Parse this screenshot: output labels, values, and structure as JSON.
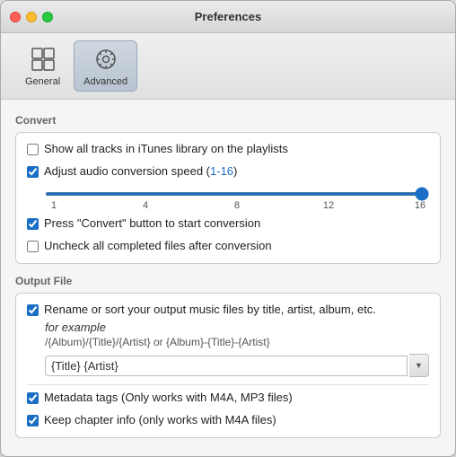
{
  "window": {
    "title": "Preferences"
  },
  "toolbar": {
    "buttons": [
      {
        "id": "general",
        "label": "General",
        "icon": "⊞",
        "active": false
      },
      {
        "id": "advanced",
        "label": "Advanced",
        "icon": "⚙",
        "active": true
      }
    ]
  },
  "convert_section": {
    "label": "Convert",
    "items": [
      {
        "id": "show-all-tracks",
        "checked": false,
        "label": "Show all tracks in iTunes library on the playlists"
      },
      {
        "id": "adjust-audio-speed",
        "checked": true,
        "label_plain": "Adjust audio conversion speed (",
        "label_blue": "1-16",
        "label_end": ")"
      },
      {
        "id": "press-convert",
        "checked": true,
        "label": "Press \"Convert\" button to start conversion"
      },
      {
        "id": "uncheck-completed",
        "checked": false,
        "label": "Uncheck all completed files after conversion"
      }
    ],
    "slider": {
      "min": 1,
      "max": 16,
      "value": 16,
      "ticks": [
        "1",
        "4",
        "8",
        "12",
        "16"
      ]
    }
  },
  "output_section": {
    "label": "Output File",
    "items": [
      {
        "id": "rename-sort",
        "checked": true,
        "label": "Rename or sort your output music files by title, artist, album, etc."
      },
      {
        "id": "metadata-tags",
        "checked": true,
        "label": "Metadata tags (Only works with M4A, MP3 files)"
      },
      {
        "id": "keep-chapter",
        "checked": true,
        "label": "Keep chapter info (only works with  M4A files)"
      }
    ],
    "rename_sub": {
      "example_label": "for example",
      "format_example": "/{Album}/{Title}/{Artist} or {Album}-{Title}-{Artist}",
      "input_value": "{Title} {Artist}",
      "input_placeholder": "{Title} {Artist}"
    }
  }
}
